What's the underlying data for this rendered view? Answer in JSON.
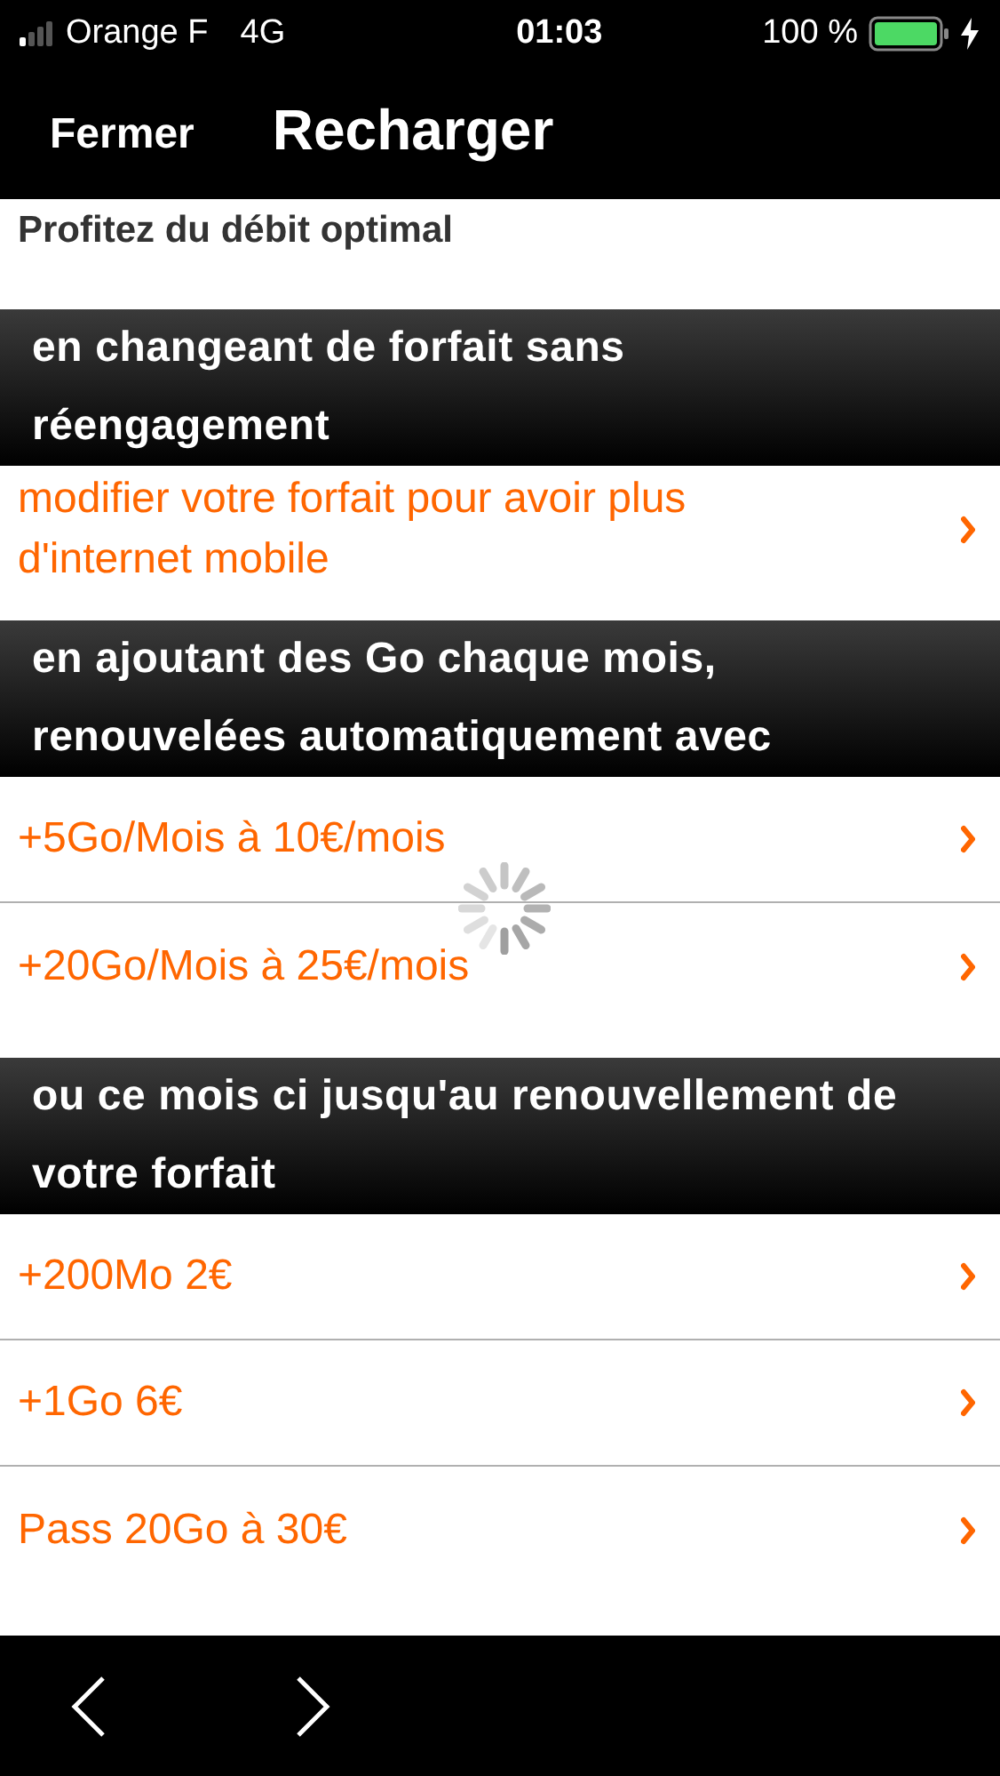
{
  "status_bar": {
    "carrier": "Orange F",
    "network": "4G",
    "time": "01:03",
    "battery": "100 %"
  },
  "nav_bar": {
    "close": "Fermer",
    "title": "Recharger"
  },
  "intro": "Profitez du débit optimal",
  "sections": [
    {
      "header": "en changeant de forfait sans réengagement",
      "items": [
        {
          "label": "modifier votre forfait pour avoir plus d'internet mobile"
        }
      ]
    },
    {
      "header": "en ajoutant des Go chaque mois, renouvelées automatiquement avec",
      "items": [
        {
          "label": "+5Go/Mois à 10€/mois"
        },
        {
          "label": "+20Go/Mois à 25€/mois"
        }
      ]
    },
    {
      "header": "ou ce mois ci jusqu'au renouvellement de votre forfait",
      "items": [
        {
          "label": "+200Mo 2€"
        },
        {
          "label": "+1Go 6€"
        },
        {
          "label": "Pass 20Go à 30€"
        }
      ]
    }
  ],
  "loading": true
}
